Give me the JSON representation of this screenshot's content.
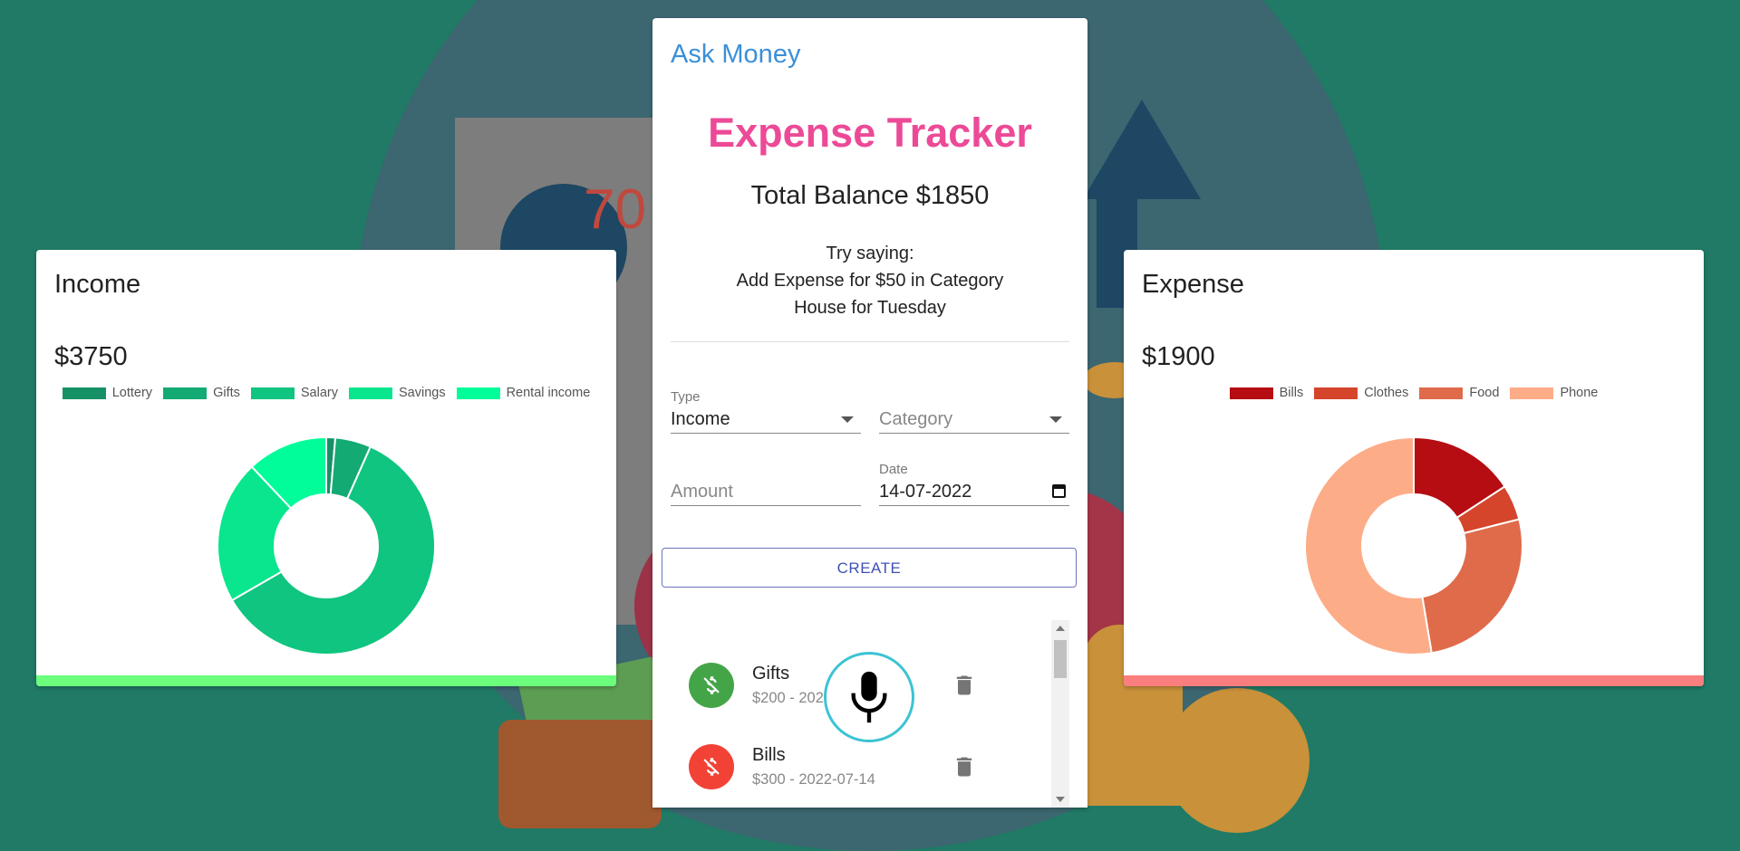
{
  "colors": {
    "page_bg": "#207a65",
    "brand": "#3b8fd8",
    "heading": "#ec4a97",
    "income_bar": "#6bff7c",
    "expense_bar": "#fa7e7e",
    "income_avatar": "#44a548",
    "expense_avatar": "#f24236",
    "mic_ring": "#3cc3d3"
  },
  "income": {
    "title": "Income",
    "amount": "$3750",
    "chart_data": {
      "type": "pie",
      "categories": [
        "Lottery",
        "Gifts",
        "Salary",
        "Savings",
        "Rental income"
      ],
      "values": [
        50,
        200,
        2250,
        800,
        450
      ],
      "colors": [
        "#169166",
        "#13aa74",
        "#0fc57f",
        "#09e68d",
        "#00fd9a"
      ]
    }
  },
  "expense": {
    "title": "Expense",
    "amount": "$1900",
    "chart_data": {
      "type": "pie",
      "categories": [
        "Bills",
        "Clothes",
        "Food",
        "Phone"
      ],
      "values": [
        300,
        100,
        500,
        1000
      ],
      "colors": [
        "#b50d12",
        "#d4452b",
        "#df6b4b",
        "#fdac88"
      ]
    }
  },
  "tracker": {
    "brand": "Ask Money",
    "heading": "Expense Tracker",
    "balance": "Total Balance $1850",
    "hint_line1": "Try saying:",
    "hint_line2": "Add Expense for $50 in Category",
    "hint_line3": "House for Tuesday",
    "form": {
      "type_label": "Type",
      "type_value": "Income",
      "category_placeholder": "Category",
      "amount_placeholder": "Amount",
      "date_label": "Date",
      "date_value": "14-07-2022",
      "create_label": "CREATE"
    },
    "transactions": [
      {
        "name": "Gifts",
        "detail": "$200 - 2022-07-14",
        "kind": "income"
      },
      {
        "name": "Bills",
        "detail": "$300 - 2022-07-14",
        "kind": "expense"
      }
    ]
  },
  "icons": {
    "avatar": "dollar-off-icon",
    "delete": "trash-icon",
    "mic": "microphone-icon",
    "calendar": "calendar-icon",
    "dropdown": "caret-down-icon"
  }
}
